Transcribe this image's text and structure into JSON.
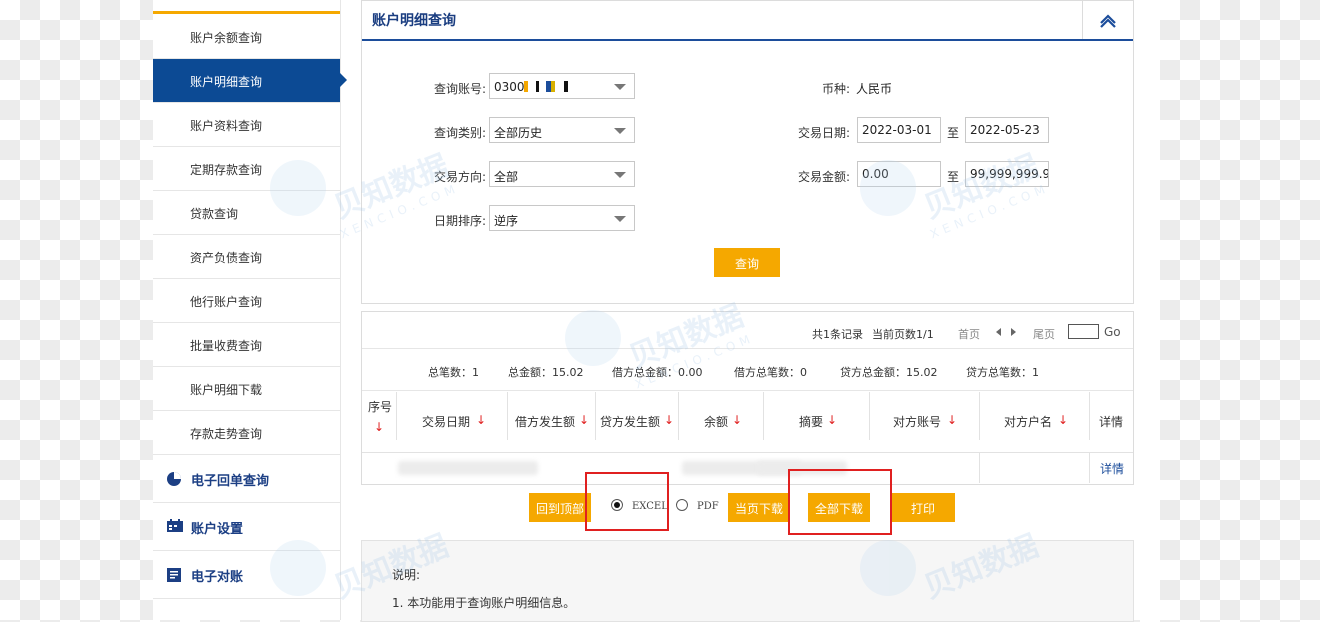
{
  "sidebar": {
    "items": [
      {
        "label": "账户余额查询"
      },
      {
        "label": "账户明细查询"
      },
      {
        "label": "账户资料查询"
      },
      {
        "label": "定期存款查询"
      },
      {
        "label": "贷款查询"
      },
      {
        "label": "资产负债查询"
      },
      {
        "label": "他行账户查询"
      },
      {
        "label": "批量收费查询"
      },
      {
        "label": "账户明细下载"
      },
      {
        "label": "存款走势查询"
      }
    ],
    "sections": [
      {
        "label": "电子回单查询",
        "icon": "pie-chart-icon"
      },
      {
        "label": "账户设置",
        "icon": "calendar-icon"
      },
      {
        "label": "电子对账",
        "icon": "document-icon"
      }
    ]
  },
  "query": {
    "title": "账户明细查询",
    "account_label": "查询账号:",
    "account_value": "0300",
    "currency_label": "币种:",
    "currency_value": "人民币",
    "type_label": "查询类别:",
    "type_value": "全部历史",
    "date_label": "交易日期:",
    "date_from": "2022-03-01",
    "date_to": "2022-05-23",
    "to_sep": "至",
    "direction_label": "交易方向:",
    "direction_value": "全部",
    "amount_label": "交易金额:",
    "amount_from": "0.00",
    "amount_to": "99,999,999.9",
    "sort_label": "日期排序:",
    "sort_value": "逆序",
    "query_button": "查询"
  },
  "results": {
    "pager": {
      "records": "共1条记录",
      "page": "当前页数1/1",
      "first": "首页",
      "last": "尾页",
      "go": "Go"
    },
    "summary": [
      "总笔数：1",
      "总金额：15.02",
      "借方总金额：0.00",
      "借方总笔数：0",
      "贷方总金额：15.02",
      "贷方总笔数：1"
    ],
    "headers": [
      "序号",
      "交易日期",
      "借方发生额",
      "贷方发生额",
      "余额",
      "摘要",
      "对方账号",
      "对方户名",
      "详情"
    ],
    "sort_arrow": "↓",
    "detail_link": "详情"
  },
  "actions": {
    "top": "回到顶部",
    "excel": "EXCEL",
    "pdf": "PDF",
    "page_download": "当页下载",
    "all_download": "全部下载",
    "print": "打印",
    "selected_format": "EXCEL"
  },
  "notes": {
    "title": "说明:",
    "items": [
      "1.  本功能用于查询账户明细信息。"
    ]
  },
  "watermark": {
    "brand": "贝知数据",
    "sub": "XENCIO.COM"
  },
  "colors": {
    "primary_blue": "#0c4a94",
    "accent_orange": "#f5a800",
    "highlight_red": "#e02020"
  }
}
